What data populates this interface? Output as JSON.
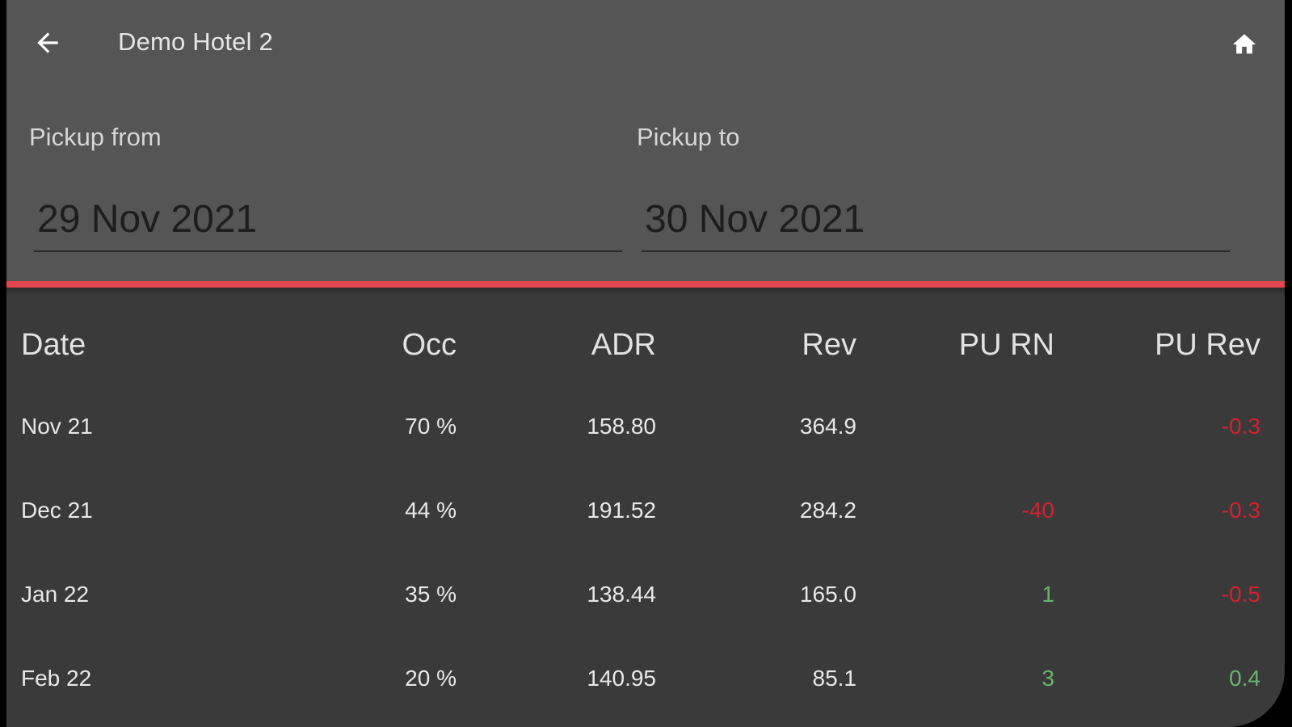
{
  "header": {
    "title": "Demo Hotel 2",
    "back_icon": "arrow-left-icon",
    "home_icon": "home-icon"
  },
  "filters": {
    "from_label": "Pickup from",
    "from_value": "29 Nov 2021",
    "to_label": "Pickup to",
    "to_value": "30 Nov 2021"
  },
  "colors": {
    "accent": "#e4464f",
    "negative": "#d2222d",
    "positive": "#69b36c",
    "panel": "#555555",
    "table_bg": "#3a3a3a"
  },
  "table": {
    "columns": [
      "Date",
      "Occ",
      "ADR",
      "Rev",
      "PU RN",
      "PU Rev"
    ],
    "rows": [
      {
        "date": "Nov 21",
        "occ": "70 %",
        "adr": "158.80",
        "rev": "364.9",
        "pu_rn": "",
        "pu_rev": "-0.3"
      },
      {
        "date": "Dec 21",
        "occ": "44 %",
        "adr": "191.52",
        "rev": "284.2",
        "pu_rn": "-40",
        "pu_rev": "-0.3"
      },
      {
        "date": "Jan 22",
        "occ": "35 %",
        "adr": "138.44",
        "rev": "165.0",
        "pu_rn": "1",
        "pu_rev": "-0.5"
      },
      {
        "date": "Feb 22",
        "occ": "20 %",
        "adr": "140.95",
        "rev": "85.1",
        "pu_rn": "3",
        "pu_rev": "0.4"
      }
    ]
  }
}
